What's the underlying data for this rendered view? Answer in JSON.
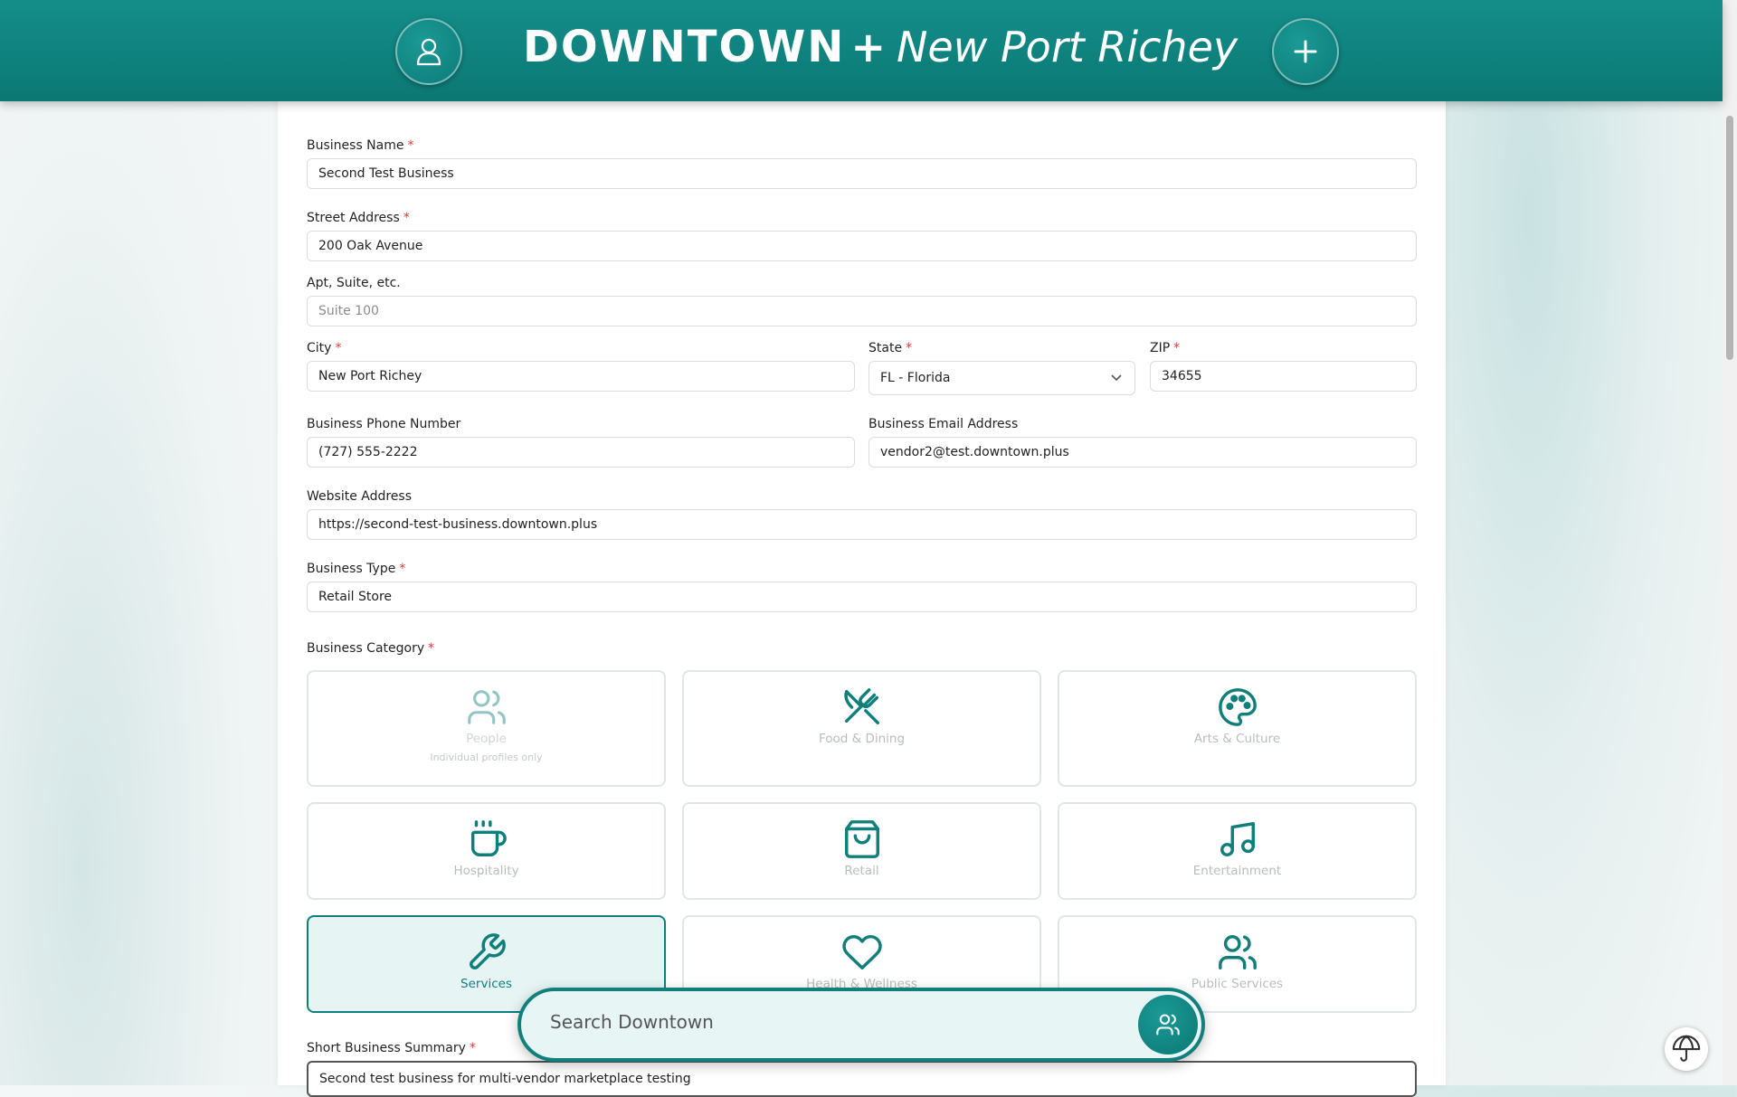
{
  "header": {
    "brand": "DOWNTOWN",
    "plus": "+",
    "city": "New Port Richey",
    "profile_icon": "user-icon",
    "add_icon": "plus-icon"
  },
  "form": {
    "business_name": {
      "label": "Business Name",
      "required": "*",
      "value": "Second Test Business"
    },
    "street_address": {
      "label": "Street Address",
      "required": "*",
      "value": "200 Oak Avenue"
    },
    "apt_suite": {
      "label": "Apt, Suite, etc.",
      "placeholder": "Suite 100"
    },
    "city": {
      "label": "City",
      "required": "*",
      "value": "New Port Richey"
    },
    "state": {
      "label": "State",
      "required": "*",
      "value": "FL - Florida"
    },
    "zip": {
      "label": "ZIP",
      "required": "*",
      "value": "34655"
    },
    "phone": {
      "label": "Business Phone Number",
      "value": "(727) 555-2222"
    },
    "email": {
      "label": "Business Email Address",
      "value": "vendor2@test.downtown.plus"
    },
    "website": {
      "label": "Website Address",
      "value": "https://second-test-business.downtown.plus"
    },
    "business_type": {
      "label": "Business Type",
      "required": "*",
      "value": "Retail Store"
    },
    "category": {
      "label": "Business Category",
      "required": "*",
      "selected": "Services",
      "items": [
        {
          "name": "People",
          "sub": "Individual profiles only",
          "icon": "users-icon"
        },
        {
          "name": "Food & Dining",
          "icon": "utensils-icon"
        },
        {
          "name": "Arts & Culture",
          "icon": "palette-icon"
        },
        {
          "name": "Hospitality",
          "icon": "coffee-icon"
        },
        {
          "name": "Retail",
          "icon": "shopping-bag-icon"
        },
        {
          "name": "Entertainment",
          "icon": "music-icon"
        },
        {
          "name": "Services",
          "icon": "wrench-icon"
        },
        {
          "name": "Health & Wellness",
          "icon": "heart-icon"
        },
        {
          "name": "Public Services",
          "icon": "users-icon"
        }
      ]
    },
    "summary": {
      "label": "Short Business Summary",
      "required": "*",
      "value": "Second test business for multi-vendor marketplace testing"
    }
  },
  "search": {
    "placeholder": "Search Downtown",
    "button_icon": "users-icon"
  },
  "help_icon": "umbrella-icon",
  "colors": {
    "accent": "#0f7f7b",
    "required": "#e03a3a"
  }
}
